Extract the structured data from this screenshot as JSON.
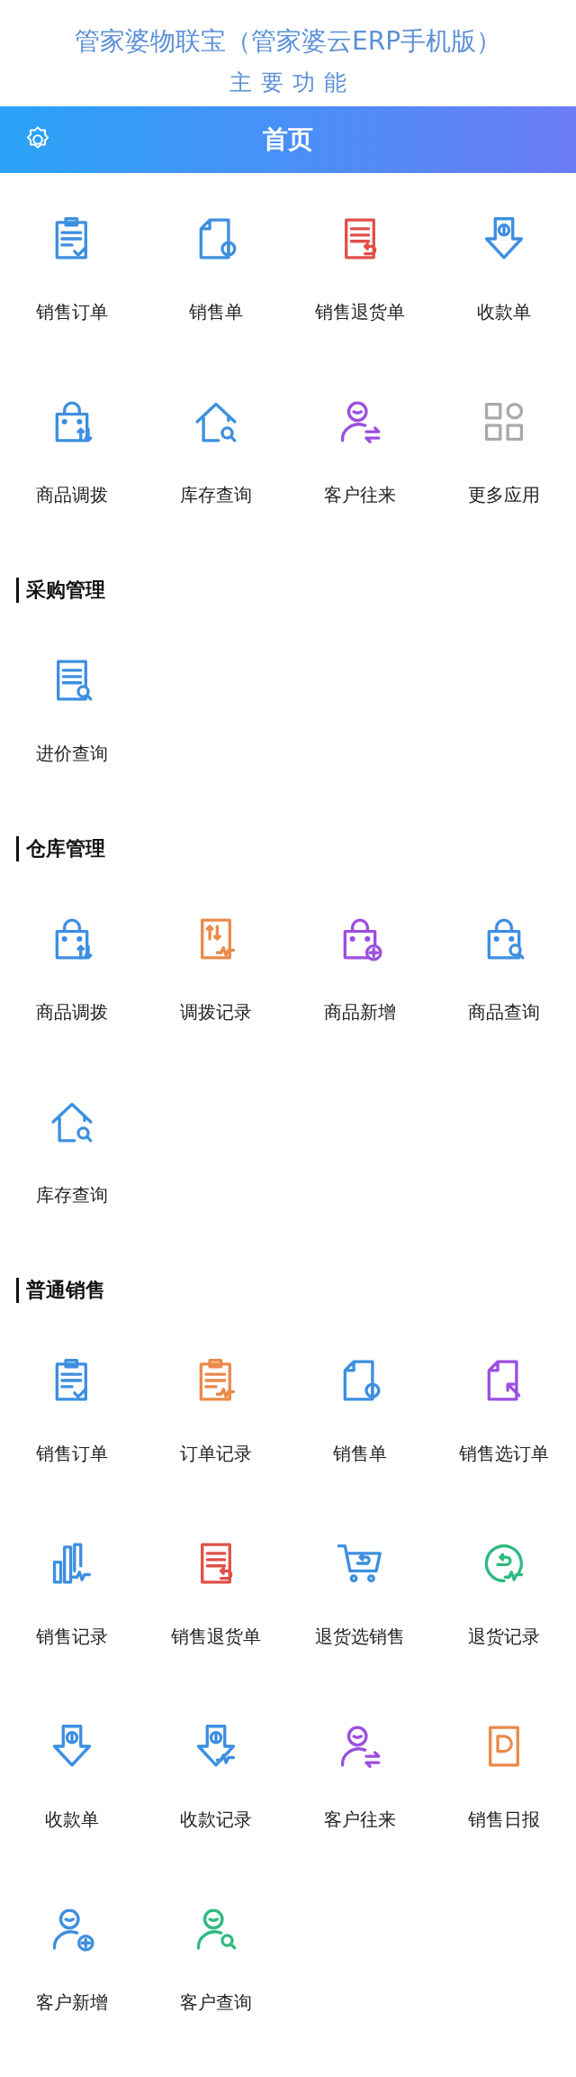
{
  "header": {
    "title": "管家婆物联宝（管家婆云ERP手机版）",
    "subtitle": "主要功能"
  },
  "navbar": {
    "title": "首页"
  },
  "sections": [
    {
      "items": [
        {
          "label": "销售订单",
          "kind": "clipboard-check",
          "color": "#3d8fe0"
        },
        {
          "label": "销售单",
          "kind": "doc-coin",
          "color": "#3d8fe0"
        },
        {
          "label": "销售退货单",
          "kind": "doc-return",
          "color": "#e0504a"
        },
        {
          "label": "收款单",
          "kind": "arrow-coin",
          "color": "#3d8fe0"
        },
        {
          "label": "商品调拨",
          "kind": "bag-transfer",
          "color": "#3d8fe0"
        },
        {
          "label": "库存查询",
          "kind": "house-search",
          "color": "#3d8fe0"
        },
        {
          "label": "客户往来",
          "kind": "person-transfer",
          "color": "#9b4fe0"
        },
        {
          "label": "更多应用",
          "kind": "grid",
          "color": "#aaaaaa"
        }
      ]
    },
    {
      "title": "采购管理",
      "items": [
        {
          "label": "进价查询",
          "kind": "doc-search",
          "color": "#3d8fe0"
        }
      ]
    },
    {
      "title": "仓库管理",
      "items": [
        {
          "label": "商品调拨",
          "kind": "bag-transfer",
          "color": "#3d8fe0"
        },
        {
          "label": "调拨记录",
          "kind": "doc-transfer-pulse",
          "color": "#eb8a4a"
        },
        {
          "label": "商品新增",
          "kind": "bag-add",
          "color": "#9b4fe0"
        },
        {
          "label": "商品查询",
          "kind": "bag-search",
          "color": "#3d8fe0"
        },
        {
          "label": "库存查询",
          "kind": "house-search",
          "color": "#3d8fe0"
        }
      ]
    },
    {
      "title": "普通销售",
      "items": [
        {
          "label": "销售订单",
          "kind": "clipboard-check",
          "color": "#3d8fe0"
        },
        {
          "label": "订单记录",
          "kind": "clipboard-pulse",
          "color": "#eb8a4a"
        },
        {
          "label": "销售单",
          "kind": "doc-coin",
          "color": "#3d8fe0"
        },
        {
          "label": "销售选订单",
          "kind": "doc-pointer",
          "color": "#9b4fe0"
        },
        {
          "label": "销售记录",
          "kind": "bars-pulse",
          "color": "#3d8fe0"
        },
        {
          "label": "销售退货单",
          "kind": "doc-return",
          "color": "#e0504a"
        },
        {
          "label": "退货选销售",
          "kind": "cart-return",
          "color": "#3d8fe0"
        },
        {
          "label": "退货记录",
          "kind": "circle-return-pulse",
          "color": "#2dbb7f"
        },
        {
          "label": "收款单",
          "kind": "arrow-coin",
          "color": "#3d8fe0"
        },
        {
          "label": "收款记录",
          "kind": "arrow-coin-pulse",
          "color": "#3d8fe0"
        },
        {
          "label": "客户往来",
          "kind": "person-transfer",
          "color": "#9b4fe0"
        },
        {
          "label": "销售日报",
          "kind": "doc-frame",
          "color": "#eb8a4a"
        },
        {
          "label": "客户新增",
          "kind": "person-add",
          "color": "#3d8fe0"
        },
        {
          "label": "客户查询",
          "kind": "person-search",
          "color": "#2dbb7f"
        }
      ]
    }
  ]
}
